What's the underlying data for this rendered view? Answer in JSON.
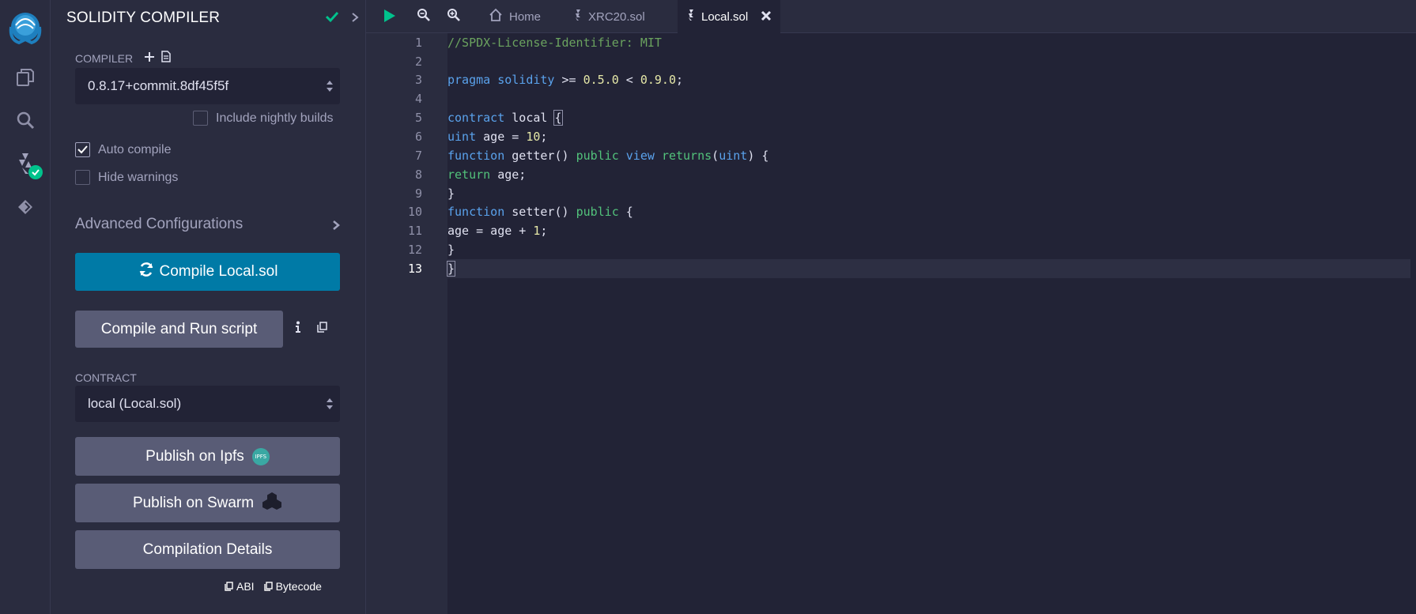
{
  "panel": {
    "title": "SOLIDITY COMPILER",
    "compiler_label": "COMPILER",
    "compiler_version": "0.8.17+commit.8df45f5f",
    "include_nightly": {
      "label": "Include nightly builds",
      "checked": false
    },
    "auto_compile": {
      "label": "Auto compile",
      "checked": true
    },
    "hide_warnings": {
      "label": "Hide warnings",
      "checked": false
    },
    "advanced": "Advanced Configurations",
    "compile_button": "Compile Local.sol",
    "compile_run_button": "Compile and Run script",
    "contract_label": "CONTRACT",
    "contract_value": "local (Local.sol)",
    "publish_ipfs": "Publish on Ipfs",
    "ipfs_badge": "IPFS",
    "publish_swarm": "Publish on Swarm",
    "compilation_details": "Compilation Details",
    "abi_link": "ABI",
    "bytecode_link": "Bytecode"
  },
  "tabs": [
    {
      "label": "Home",
      "icon": "home-icon"
    },
    {
      "label": "XRC20.sol",
      "icon": "solidity-icon"
    },
    {
      "label": "Local.sol",
      "icon": "solidity-icon",
      "active": true
    }
  ],
  "editor": {
    "line_numbers": [
      "1",
      "2",
      "3",
      "4",
      "5",
      "6",
      "7",
      "8",
      "9",
      "10",
      "11",
      "12",
      "13"
    ],
    "active_line": "13"
  },
  "colors": {
    "accent": "#007aa6",
    "success": "#00c28c",
    "background": "#222336",
    "panel": "#2a2c3f"
  }
}
